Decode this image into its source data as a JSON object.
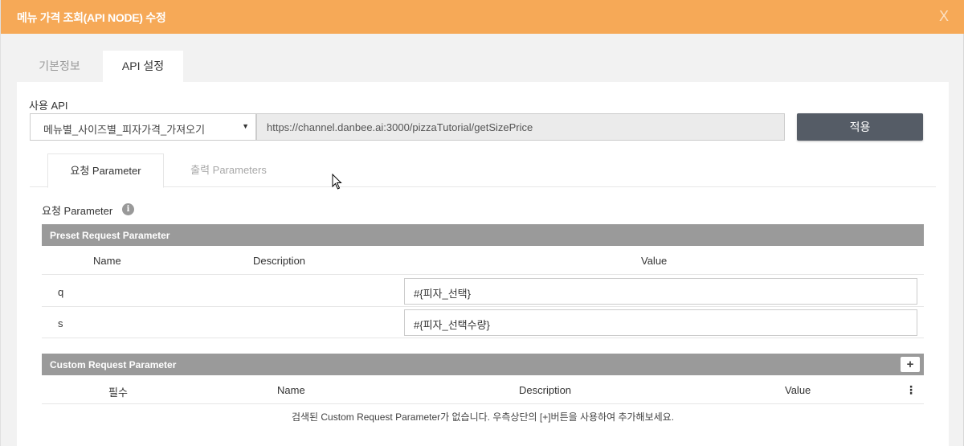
{
  "modal": {
    "title": "메뉴 가격 조회(API NODE) 수정",
    "close_label": "X"
  },
  "main_tabs": [
    {
      "label": "기본정보",
      "active": false
    },
    {
      "label": "API 설정",
      "active": true
    }
  ],
  "api": {
    "label": "사용 API",
    "selected": "메뉴별_사이즈별_피자가격_가져오기",
    "caret": "▼",
    "url": "https://channel.danbee.ai:3000/pizzaTutorial/getSizePrice",
    "apply_label": "적용"
  },
  "sub_tabs": [
    {
      "label": "요청 Parameter",
      "active": true
    },
    {
      "label": "출력 Parameters",
      "active": false
    }
  ],
  "request": {
    "title": "요청 Parameter",
    "info_glyph": "i"
  },
  "preset": {
    "header": "Preset Request Parameter",
    "columns": [
      "Name",
      "Description",
      "Value"
    ],
    "rows": [
      {
        "name": "q",
        "description": "",
        "value": "#{피자_선택}"
      },
      {
        "name": "s",
        "description": "",
        "value": "#{피자_선택수량}"
      }
    ]
  },
  "custom": {
    "header": "Custom Request Parameter",
    "add_label": "+",
    "columns": [
      "필수",
      "Name",
      "Description",
      "Value"
    ],
    "menu_glyph": "⋮",
    "empty_message": "검색된 Custom Request Parameter가 없습니다. 우측상단의 [+]버튼을 사용하여 추가해보세요."
  },
  "colors": {
    "header_bg": "#f6a957",
    "bar_bg": "#9a9a9a",
    "apply_bg": "#555c66"
  }
}
